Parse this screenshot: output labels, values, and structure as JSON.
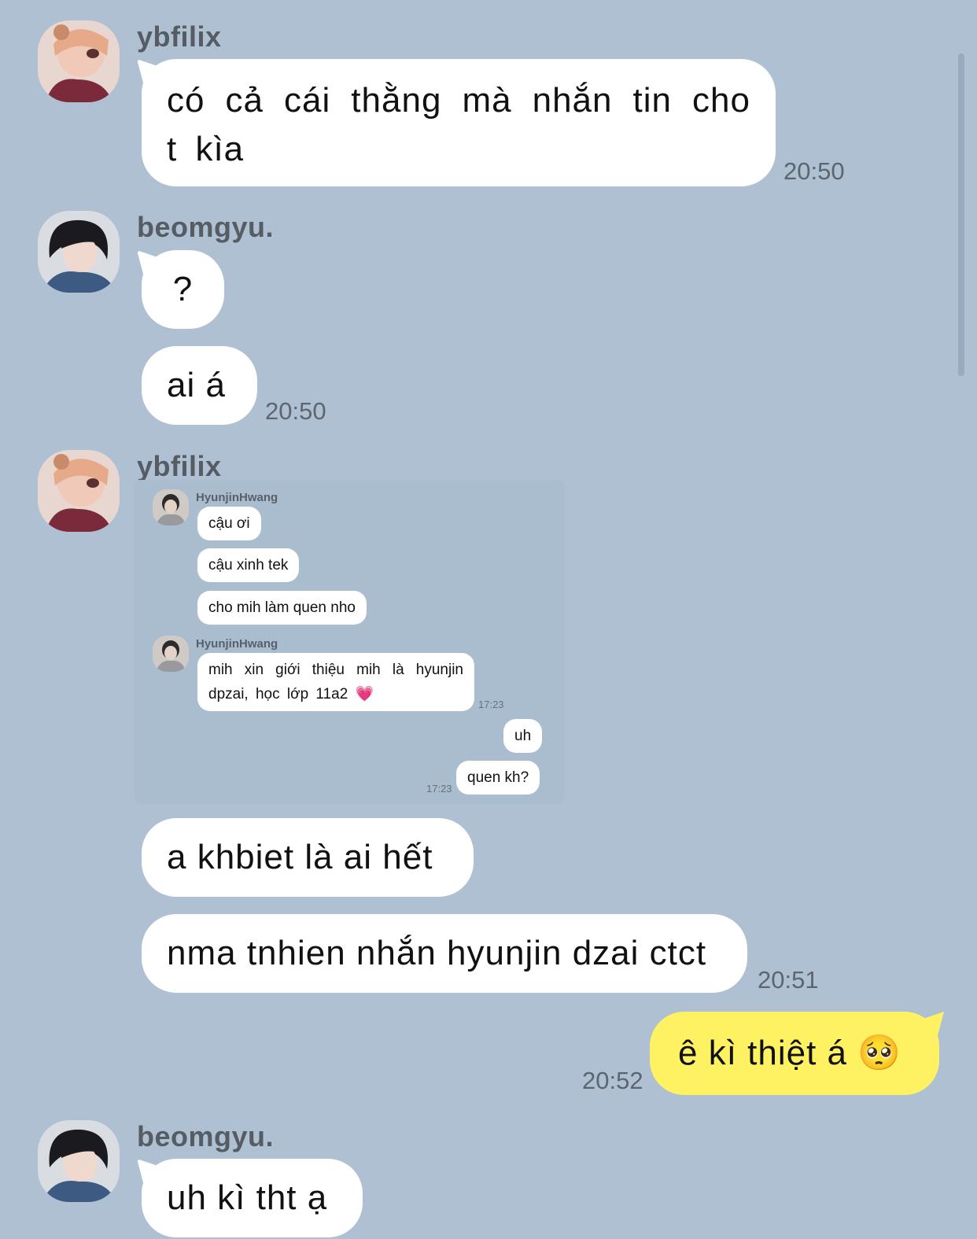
{
  "messages": {
    "m1": {
      "sender": "ybfilix",
      "text": "có cả cái thằng mà nhắn tin cho t kìa",
      "time": "20:50"
    },
    "m2": {
      "sender": "beomgyu.",
      "text1": "?",
      "text2": "ai á",
      "time": "20:50"
    },
    "m3": {
      "sender": "ybfilix",
      "embed": {
        "name1": "HyunjinHwang",
        "b1": "cậu ơi",
        "b2": "cậu xinh tek",
        "b3": "cho mih làm quen nho",
        "name2": "HyunjinHwang",
        "b4": "mih xin giới thiệu mih là hyunjin dpzai, học lớp 11a2 💗",
        "t1": "17:23",
        "r1": "uh",
        "r2": "quen kh?",
        "t2": "17:23"
      },
      "text1": "a khbiet là ai hết",
      "text2": "nma tnhien nhắn hyunjin dzai ctct",
      "time": "20:51"
    },
    "m4": {
      "text": "ê kì thiệt á 🥺",
      "time": "20:52"
    },
    "m5": {
      "sender": "beomgyu.",
      "text": "uh kì tht ạ"
    }
  },
  "colors": {
    "background": "#aec0d2",
    "incoming": "#ffffff",
    "outgoing": "#fef263"
  }
}
